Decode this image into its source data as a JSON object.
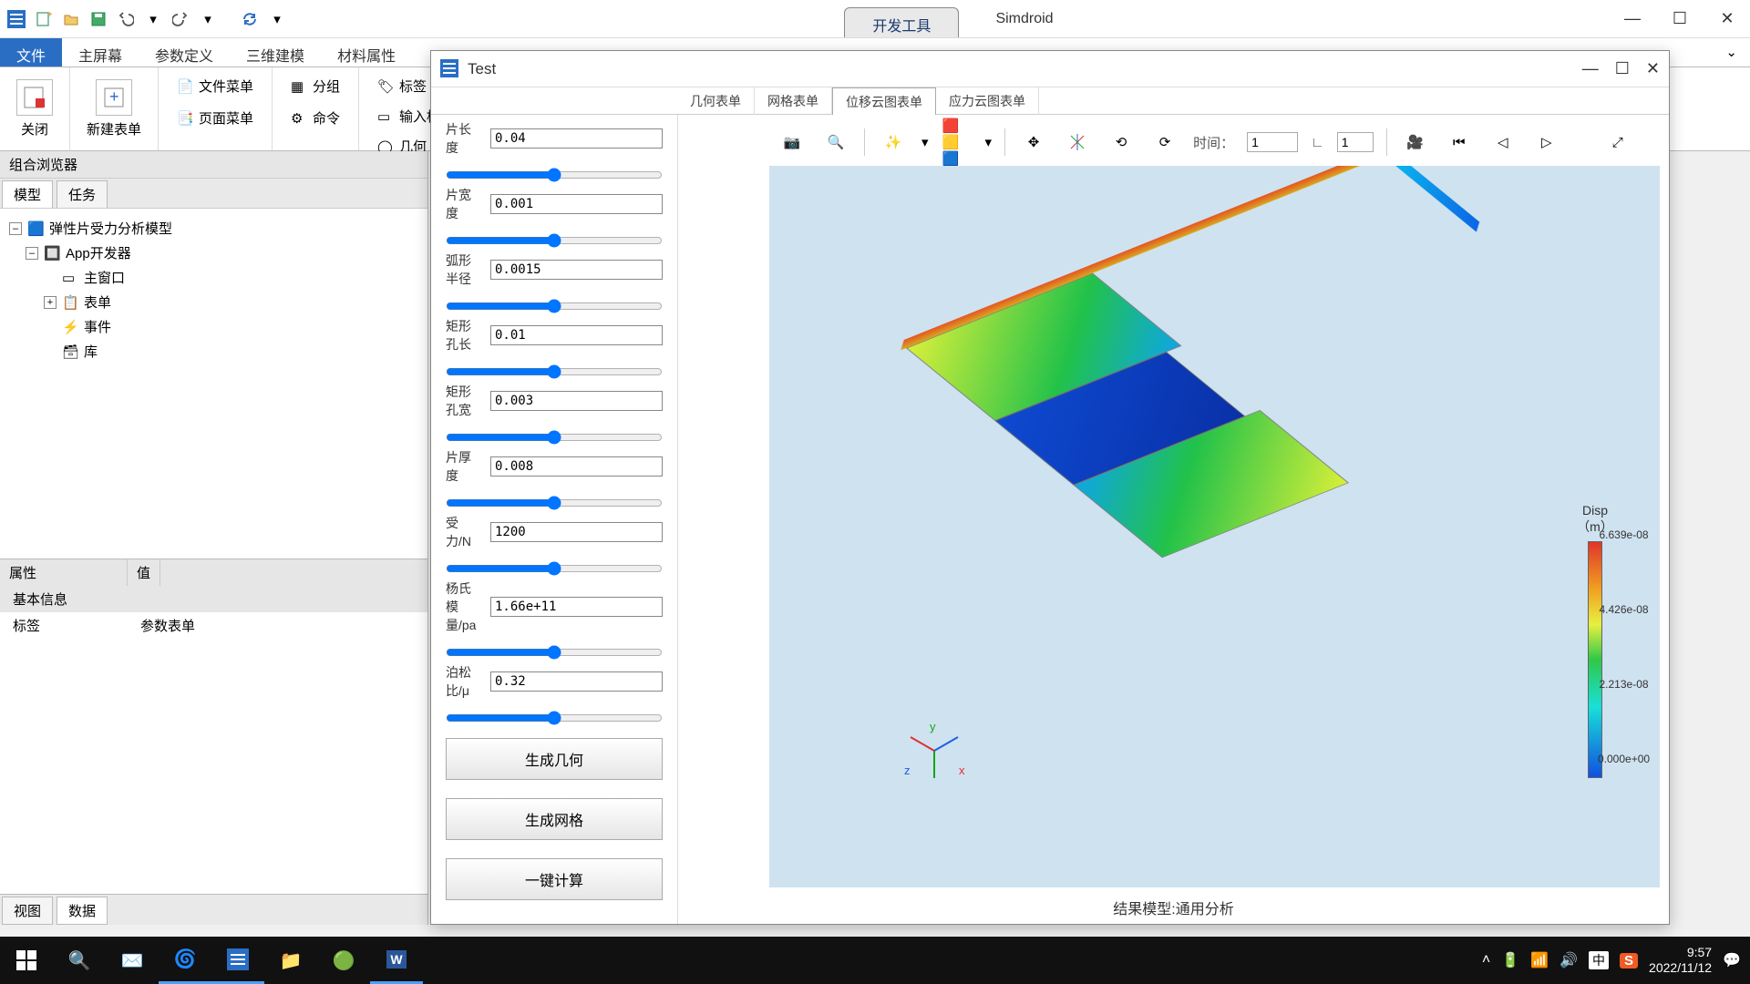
{
  "titlebar": {
    "tool_tab": "开发工具",
    "app_name": "Simdroid"
  },
  "ribbon": {
    "file": "文件",
    "tabs": [
      "主屏幕",
      "参数定义",
      "三维建模",
      "材料属性"
    ],
    "close": "关闭",
    "new_form": "新建表单",
    "file_menu": "文件菜单",
    "page_menu": "页面菜单",
    "group": "分组",
    "cmd": "命令",
    "tag": "标签",
    "input_box": "输入框",
    "geometry": "几何"
  },
  "leftpanel": {
    "title": "组合浏览器",
    "tabs": {
      "model": "模型",
      "task": "任务"
    },
    "tree": {
      "root": "弹性片受力分析模型",
      "app": "App开发器",
      "mainwin": "主窗口",
      "form": "表单",
      "event": "事件",
      "lib": "库"
    },
    "props": {
      "attr": "属性",
      "val": "值",
      "basic": "基本信息",
      "label": "标签",
      "label_val": "参数表单"
    },
    "bottom_tabs": {
      "view": "视图",
      "data": "数据"
    }
  },
  "floatwin": {
    "title": "Test",
    "tabs": [
      "几何表单",
      "网格表单",
      "位移云图表单",
      "应力云图表单"
    ],
    "active_tab_index": 2,
    "params": [
      {
        "label": "片长度",
        "value": "0.04"
      },
      {
        "label": "片宽度",
        "value": "0.001"
      },
      {
        "label": "弧形半径",
        "value": "0.0015"
      },
      {
        "label": "矩形孔长",
        "value": "0.01"
      },
      {
        "label": "矩形孔宽",
        "value": "0.003"
      },
      {
        "label": "片厚度",
        "value": "0.008"
      },
      {
        "label": "受力/N",
        "value": "1200"
      },
      {
        "label": "杨氏模量/pa",
        "value": "1.66e+11"
      },
      {
        "label": "泊松比/μ",
        "value": "0.32"
      }
    ],
    "actions": {
      "gen_geom": "生成几何",
      "gen_mesh": "生成网格",
      "compute": "一键计算"
    },
    "viewer": {
      "time_label": "时间：",
      "time_value": "1",
      "frame_value": "1",
      "legend_title": "Disp",
      "legend_unit": "（m）",
      "ticks": [
        "6.639e-08",
        "4.426e-08",
        "2.213e-08",
        "0.000e+00"
      ],
      "axes": {
        "x": "x",
        "y": "y",
        "z": "z"
      },
      "result_caption": "结果模型:通用分析"
    }
  },
  "taskbar": {
    "time": "9:57",
    "date": "2022/11/12",
    "ime": "中",
    "sogou": "S"
  }
}
